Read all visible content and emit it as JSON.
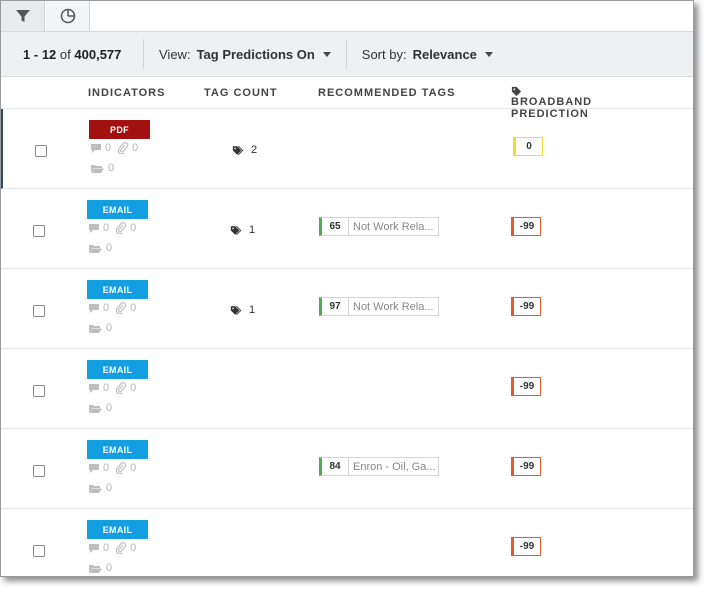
{
  "toolbar": {
    "range_start": "1",
    "range_dash": "-",
    "range_end": "12",
    "of_text": "of",
    "total": "400,577",
    "view_label": "View:",
    "view_value": "Tag Predictions On",
    "sort_label": "Sort by:",
    "sort_value": "Relevance"
  },
  "columns": {
    "indicators": "INDICATORS",
    "tag_count": "TAG COUNT",
    "recommended_tags": "RECOMMENDED TAGS",
    "broadband_prediction": "BROADBAND PREDICTION"
  },
  "colors": {
    "pdf": "#a31010",
    "email": "#129ee0",
    "tag_bar": "#4caf50",
    "pred_negative": "#e85b27",
    "pred_zero": "#f2dc30"
  },
  "rows": [
    {
      "type": "PDF",
      "comments": "0",
      "attachments": "0",
      "folders": "0",
      "tag_count": "2",
      "rec_score": "",
      "rec_label": "",
      "prediction": "0"
    },
    {
      "type": "EMAIL",
      "comments": "0",
      "attachments": "0",
      "folders": "0",
      "tag_count": "1",
      "rec_score": "65",
      "rec_label": "Not Work Rela...",
      "prediction": "-99"
    },
    {
      "type": "EMAIL",
      "comments": "0",
      "attachments": "0",
      "folders": "0",
      "tag_count": "1",
      "rec_score": "97",
      "rec_label": "Not Work Rela...",
      "prediction": "-99"
    },
    {
      "type": "EMAIL",
      "comments": "0",
      "attachments": "0",
      "folders": "0",
      "tag_count": "",
      "rec_score": "",
      "rec_label": "",
      "prediction": "-99"
    },
    {
      "type": "EMAIL",
      "comments": "0",
      "attachments": "0",
      "folders": "0",
      "tag_count": "",
      "rec_score": "84",
      "rec_label": "Enron - Oil, Ga...",
      "prediction": "-99"
    },
    {
      "type": "EMAIL",
      "comments": "0",
      "attachments": "0",
      "folders": "0",
      "tag_count": "",
      "rec_score": "",
      "rec_label": "",
      "prediction": "-99"
    }
  ]
}
